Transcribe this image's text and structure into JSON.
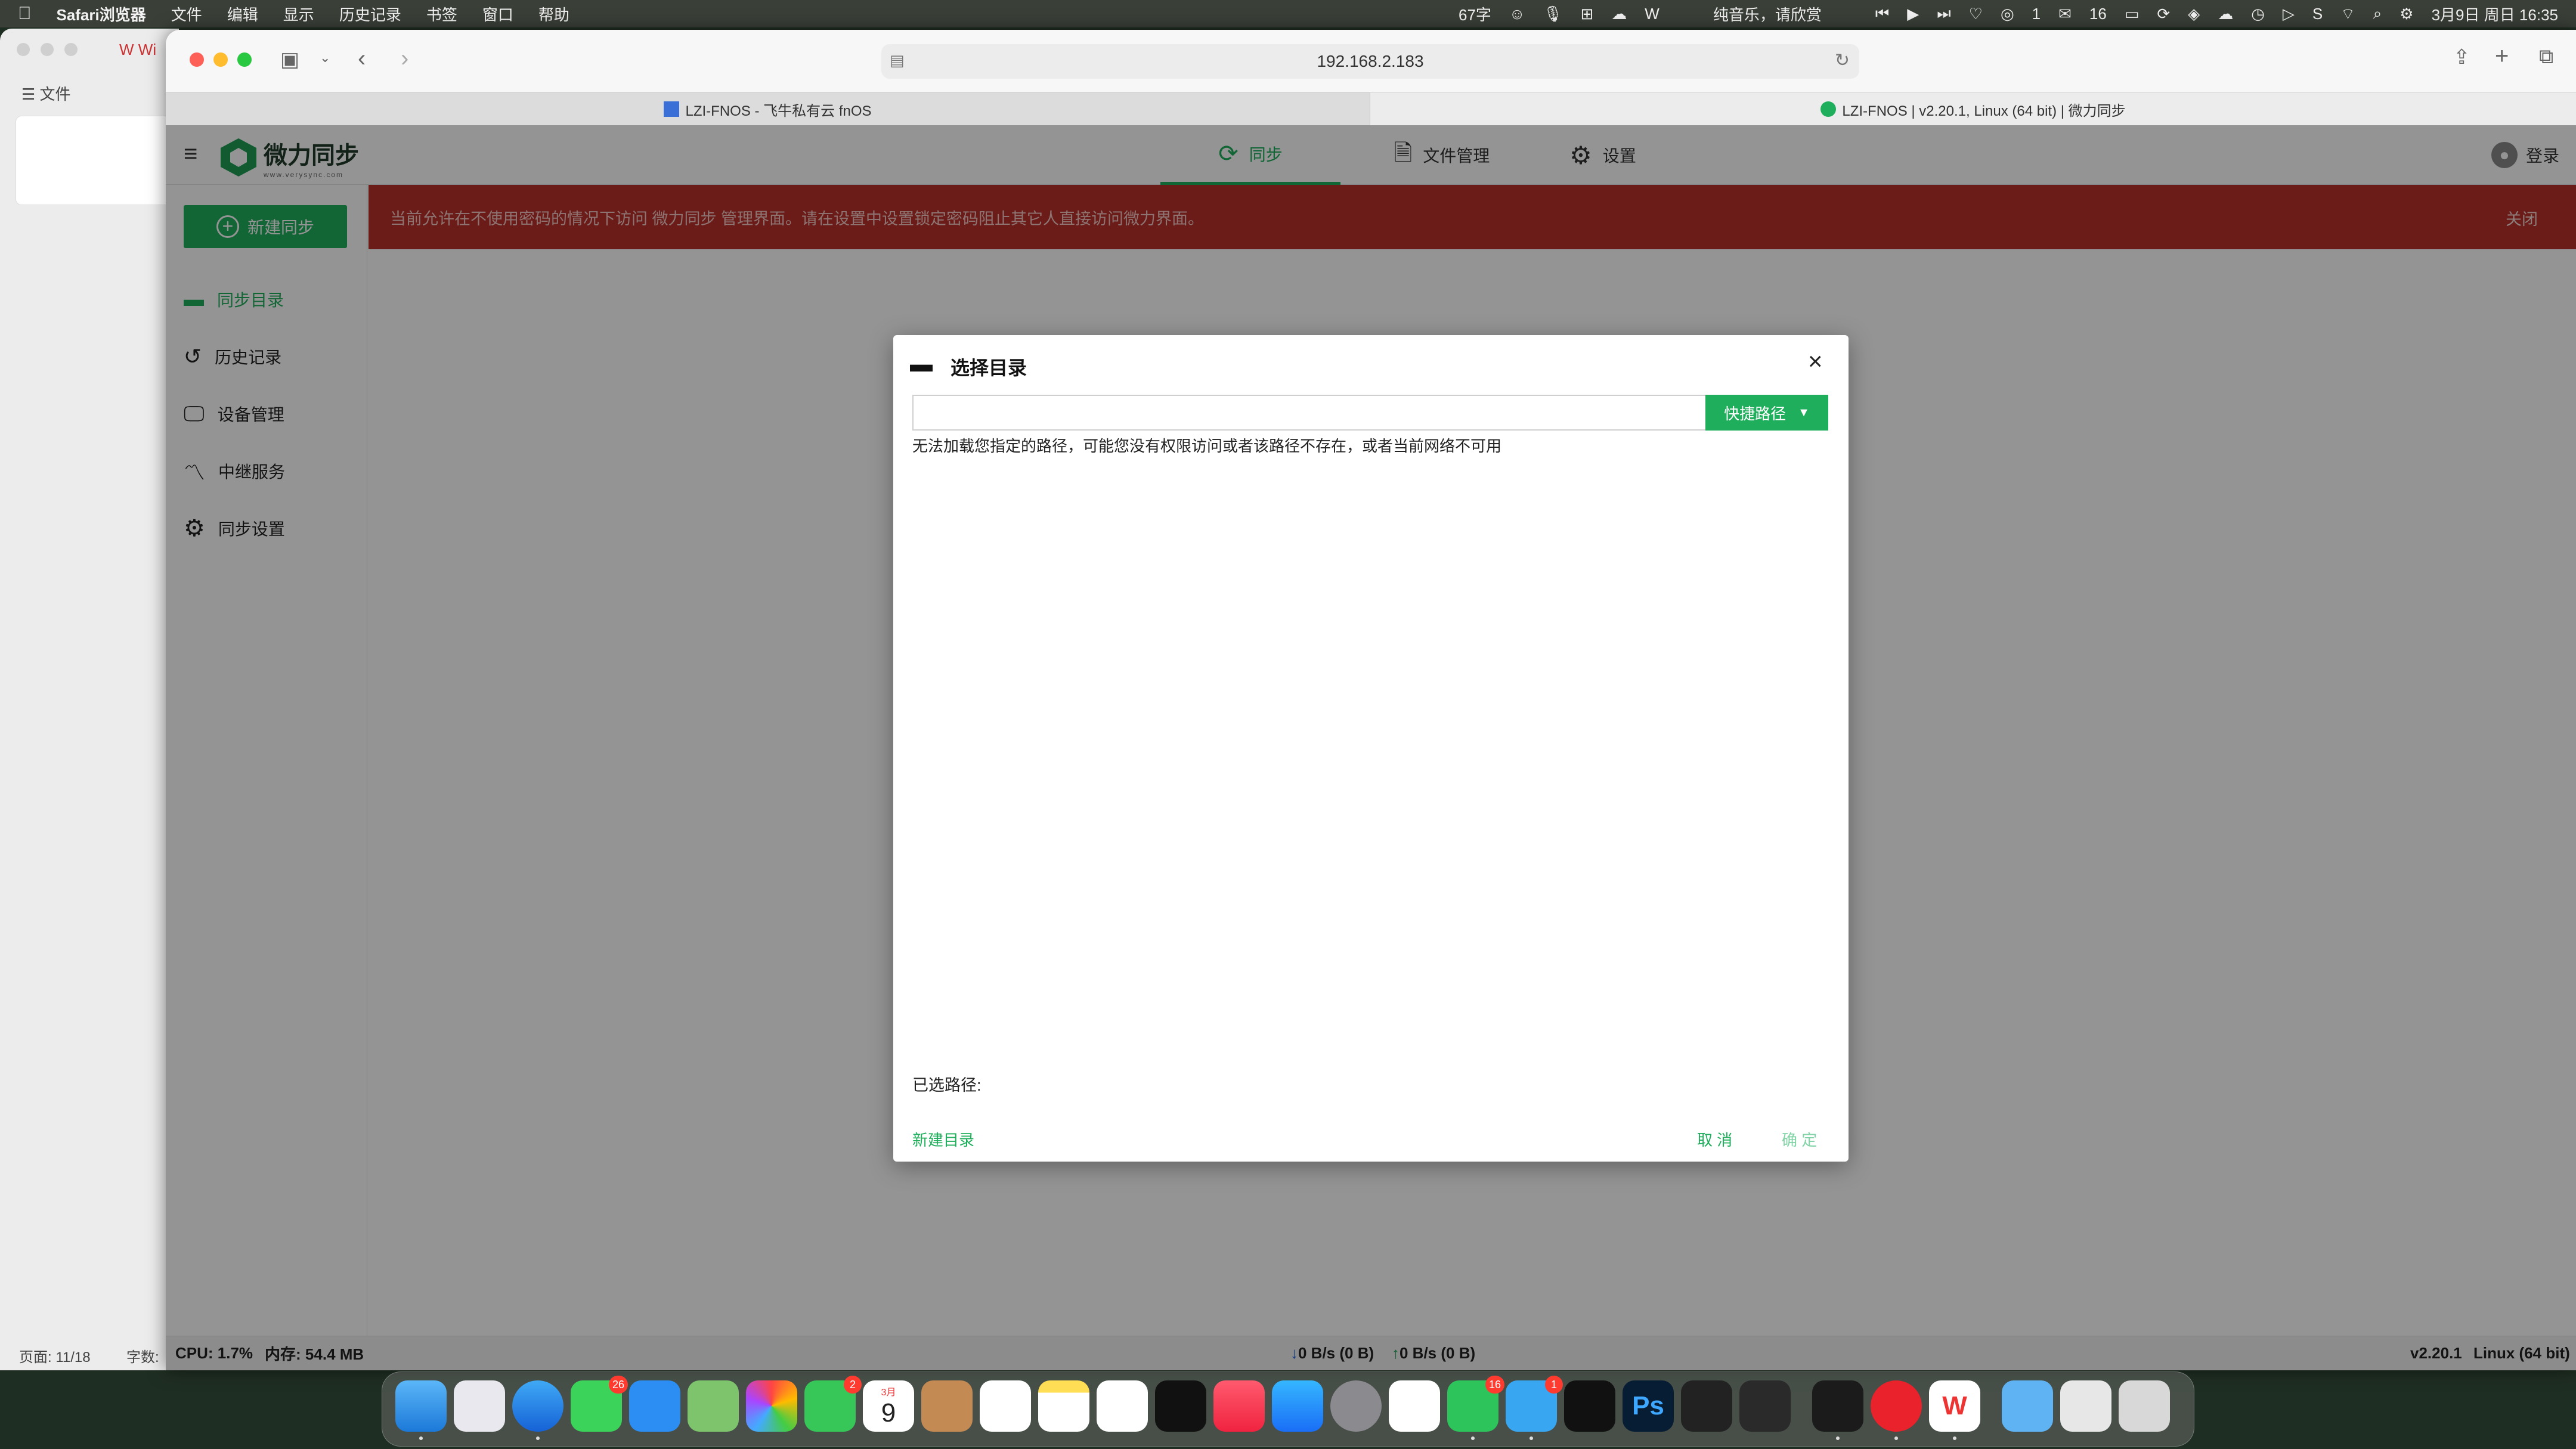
{
  "menubar": {
    "app_name": "Safari浏览器",
    "items": [
      "文件",
      "编辑",
      "显示",
      "历史记录",
      "书签",
      "窗口",
      "帮助"
    ],
    "word_count": "67字",
    "now_playing": "纯音乐，请欣赏",
    "status_count_1": "1",
    "wechat_count": "16",
    "datetime": "3月9日 周日  16:35"
  },
  "bg_window": {
    "file_label": "文件",
    "tab_partial": "Wi",
    "footer_page": "页面: 11/18",
    "footer_words": "字数:"
  },
  "browser": {
    "url": "192.168.2.183",
    "tabs": [
      {
        "label": "LZI-FNOS - 飞牛私有云 fnOS"
      },
      {
        "label": "LZI-FNOS | v2.20.1, Linux (64 bit) | 微力同步"
      }
    ]
  },
  "app": {
    "logo_text": "微力同步",
    "logo_sub": "www.verysync.com",
    "nav": [
      {
        "label": "同步",
        "icon": "sync-icon",
        "active": true
      },
      {
        "label": "文件管理",
        "icon": "document-icon",
        "active": false
      },
      {
        "label": "设置",
        "icon": "gear-icon",
        "active": false
      }
    ],
    "login_label": "登录",
    "new_sync_label": "新建同步",
    "sidebar": [
      {
        "label": "同步目录",
        "icon": "folder-icon",
        "active": true
      },
      {
        "label": "历史记录",
        "icon": "history-icon",
        "active": false
      },
      {
        "label": "设备管理",
        "icon": "device-icon",
        "active": false
      },
      {
        "label": "中继服务",
        "icon": "relay-icon",
        "active": false
      },
      {
        "label": "同步设置",
        "icon": "gear-icon",
        "active": false
      }
    ],
    "banner_text": "当前允许在不使用密码的情况下访问 微力同步 管理界面。请在设置中设置锁定密码阻止其它人直接访问微力界面。",
    "banner_close": "关闭",
    "status": {
      "cpu": "CPU: 1.7%",
      "memory": "内存: 54.4 MB",
      "download": "0 B/s (0 B)",
      "upload": "0 B/s (0 B)",
      "version": "v2.20.1",
      "os": "Linux (64 bit)"
    }
  },
  "dialog": {
    "title": "选择目录",
    "path_value": "",
    "quick_path_label": "快捷路径",
    "error_message": "无法加载您指定的路径，可能您没有权限访问或者该路径不存在，或者当前网络不可用",
    "selected_label": "已选路径:",
    "new_dir_label": "新建目录",
    "cancel_label": "取 消",
    "confirm_label": "确 定"
  },
  "dock": {
    "messages_badge": "26",
    "facetime_badge": "2",
    "calendar_month": "3月",
    "calendar_day": "9",
    "wechat_badge": "16",
    "cloud_badge": "1"
  },
  "colors": {
    "accent_green": "#1fae5b",
    "banner_red": "#b8302a"
  }
}
